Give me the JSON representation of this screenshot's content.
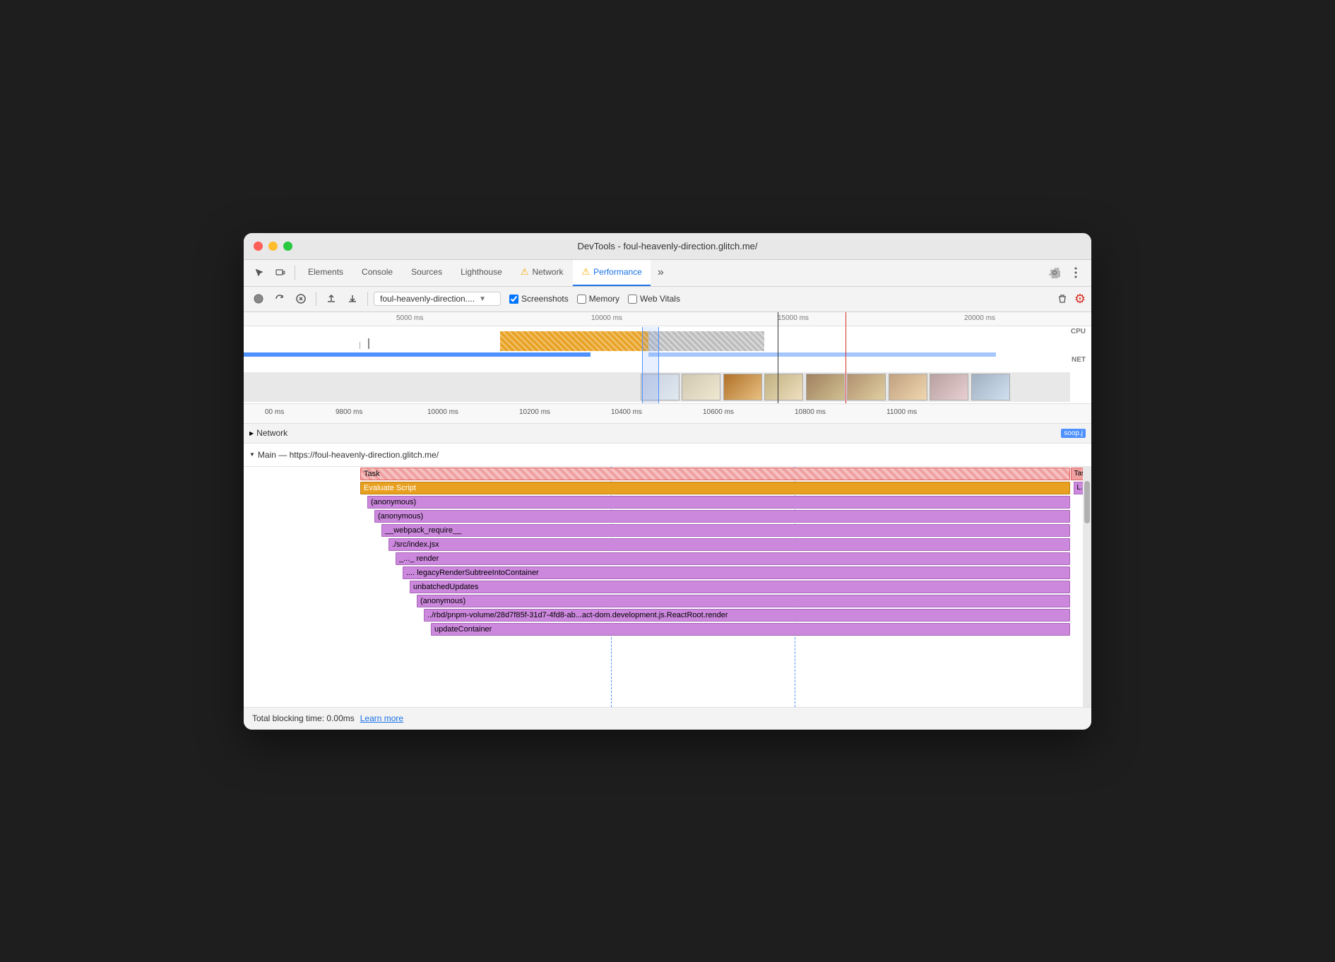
{
  "window": {
    "title": "DevTools - foul-heavenly-direction.glitch.me/"
  },
  "tabs": {
    "items": [
      {
        "label": "Elements",
        "active": false,
        "warn": false
      },
      {
        "label": "Console",
        "active": false,
        "warn": false
      },
      {
        "label": "Sources",
        "active": false,
        "warn": false
      },
      {
        "label": "Lighthouse",
        "active": false,
        "warn": false
      },
      {
        "label": "Network",
        "active": false,
        "warn": true
      },
      {
        "label": "Performance",
        "active": true,
        "warn": true
      }
    ],
    "more_label": "»"
  },
  "toolbar": {
    "url": "foul-heavenly-direction....",
    "screenshots_label": "Screenshots",
    "memory_label": "Memory",
    "web_vitals_label": "Web Vitals"
  },
  "timeline": {
    "ruler_marks": [
      "5000 ms",
      "10000 ms",
      "15000 ms",
      "20000 ms"
    ],
    "cpu_label": "CPU",
    "net_label": "NET",
    "zoom_marks": [
      "00 ms",
      "9800 ms",
      "10000 ms",
      "10200 ms",
      "10400 ms",
      "10600 ms",
      "10800 ms",
      "11000 ms"
    ]
  },
  "network_row": {
    "label": "Network",
    "tag": "soop.j"
  },
  "main_section": {
    "header": "Main — https://foul-heavenly-direction.glitch.me/",
    "task_label": "Task",
    "task_right": "Task",
    "evaluate_script_label": "Evaluate Script",
    "evaluate_script_right": "L...t",
    "flame_items": [
      {
        "label": "(anonymous)",
        "indent": 10
      },
      {
        "label": "(anonymous)",
        "indent": 20
      },
      {
        "label": "__webpack_require__",
        "indent": 30
      },
      {
        "label": "./src/index.jsx",
        "indent": 40
      },
      {
        "label": "_..._  render",
        "indent": 50
      },
      {
        "label": "....  legacyRenderSubtreeIntoContainer",
        "indent": 60
      },
      {
        "label": "unbatchedUpdates",
        "indent": 70
      },
      {
        "label": "(anonymous)",
        "indent": 80
      },
      {
        "label": "../rbd/pnpm-volume/28d7f85f-31d7-4fd8-ab...act-dom.development.js.ReactRoot.render",
        "indent": 90
      },
      {
        "label": "updateContainer",
        "indent": 100
      }
    ]
  },
  "status_bar": {
    "text": "Total blocking time: 0.00ms",
    "learn_more": "Learn more"
  }
}
